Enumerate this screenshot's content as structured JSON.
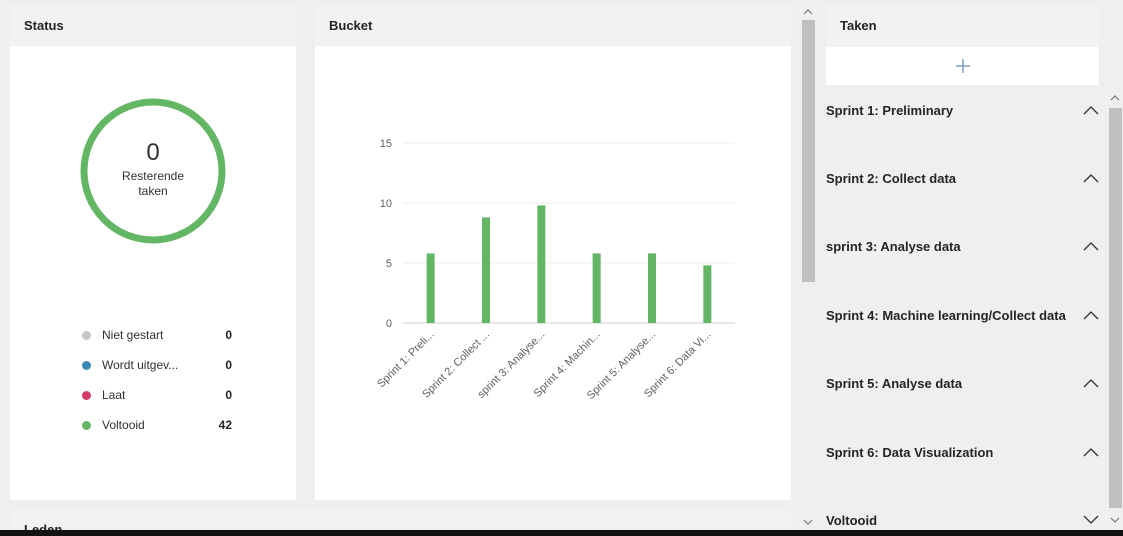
{
  "status": {
    "title": "Status",
    "donut_value": "0",
    "donut_label": "Resterende taken",
    "ring_color": "#63b663",
    "legend": [
      {
        "label": "Niet gestart",
        "count": "0",
        "color": "#c8c6c4"
      },
      {
        "label": "Wordt uitgev...",
        "count": "0",
        "color": "#3b88b7"
      },
      {
        "label": "Laat",
        "count": "0",
        "color": "#d23b65"
      },
      {
        "label": "Voltooid",
        "count": "42",
        "color": "#63b663"
      }
    ]
  },
  "bucket": {
    "title": "Bucket"
  },
  "chart_data": {
    "type": "bar",
    "categories": [
      "Sprint 1: Preli...",
      "Sprint 2: Collect ...",
      "sprint 3: Analyse...",
      "Sprint 4: Machin...",
      "Sprint 5: Analyse...",
      "Sprint 6: Data Vi..."
    ],
    "values": [
      5.8,
      8.8,
      9.8,
      5.8,
      5.8,
      4.8
    ],
    "yticks": [
      "0",
      "5",
      "10",
      "15"
    ],
    "ylim": [
      0,
      15
    ],
    "grid": true,
    "bar_color": "#63b663"
  },
  "members": {
    "title": "Leden"
  },
  "taken": {
    "title": "Taken",
    "add_icon": "+",
    "buckets": [
      {
        "label": "Sprint 1: Preliminary",
        "state": "expanded"
      },
      {
        "label": "Sprint 2: Collect data",
        "state": "expanded"
      },
      {
        "label": "sprint 3: Analyse data",
        "state": "expanded"
      },
      {
        "label": "Sprint 4: Machine learning/Collect data",
        "state": "expanded"
      },
      {
        "label": "Sprint 5: Analyse data",
        "state": "expanded"
      },
      {
        "label": "Sprint 6: Data Visualization",
        "state": "expanded"
      },
      {
        "label": "Voltooid",
        "state": "collapsed"
      }
    ]
  }
}
